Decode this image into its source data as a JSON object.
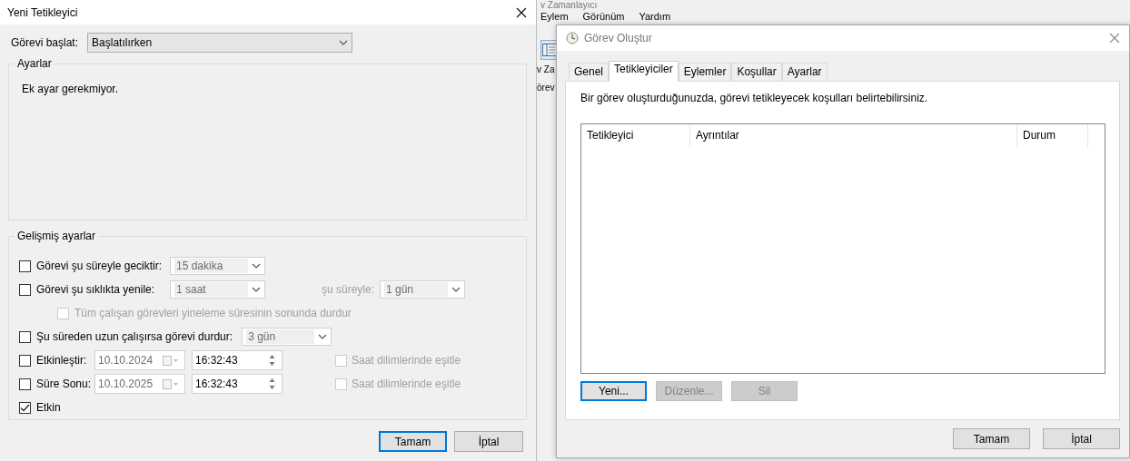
{
  "background_window": {
    "title": "v Zamanlayıcı",
    "menu": [
      "Eylem",
      "Görünüm",
      "Yardım"
    ],
    "side_labels": [
      "v Za",
      "örev"
    ]
  },
  "new_trigger_dialog": {
    "title": "Yeni Tetikleyici",
    "start_task": {
      "label": "Görevi başlat:",
      "value": "Başlatılırken"
    },
    "settings_group": {
      "title": "Ayarlar",
      "text": "Ek ayar gerekmiyor."
    },
    "advanced_group": {
      "title": "Gelişmiş ayarlar",
      "rows": [
        {
          "kind": "combo",
          "checked": false,
          "disabled": false,
          "label": "Görevi şu süreyle geciktir:",
          "value": "15 dakika"
        },
        {
          "kind": "repeat",
          "checked": false,
          "disabled": false,
          "label": "Görevi şu sıklıkta yenile:",
          "value": "1 saat",
          "duration_label": "şu süreyle:",
          "duration_value": "1 gün"
        },
        {
          "kind": "sub",
          "checked": false,
          "disabled": true,
          "label": "Tüm çalışan görevleri yineleme süresinin sonunda durdur"
        },
        {
          "kind": "stop",
          "checked": false,
          "disabled": false,
          "label": "Şu süreden uzun çalışırsa görevi durdur:",
          "value": "3 gün"
        },
        {
          "kind": "datetime",
          "checked": false,
          "disabled": false,
          "label": "Etkinleştir:",
          "date": "10.10.2024",
          "time": "16:32:43",
          "sync_label": "Saat dilimlerinde eşitle",
          "sync_checked": false
        },
        {
          "kind": "datetime",
          "checked": false,
          "disabled": false,
          "label": "Süre Sonu:",
          "date": "10.10.2025",
          "time": "16:32:43",
          "sync_label": "Saat dilimlerinde eşitle",
          "sync_checked": false
        },
        {
          "kind": "check",
          "checked": true,
          "disabled": false,
          "label": "Etkin"
        }
      ]
    },
    "buttons": [
      {
        "label": "Tamam",
        "focused": true
      },
      {
        "label": "İptal",
        "focused": false
      }
    ]
  },
  "create_task_dialog": {
    "title": "Görev Oluştur",
    "tabs": [
      {
        "label": "Genel",
        "selected": false
      },
      {
        "label": "Tetikleyiciler",
        "selected": true
      },
      {
        "label": "Eylemler",
        "selected": false
      },
      {
        "label": "Koşullar",
        "selected": false
      },
      {
        "label": "Ayarlar",
        "selected": false
      }
    ],
    "description": "Bir görev oluşturduğunuzda, görevi tetikleyecek koşulları belirtebilirsiniz.",
    "table": {
      "columns": [
        "Tetikleyici",
        "Ayrıntılar",
        "Durum"
      ]
    },
    "list_buttons": [
      {
        "label": "Yeni...",
        "focused": true,
        "disabled": false
      },
      {
        "label": "Düzenle...",
        "focused": false,
        "disabled": true
      },
      {
        "label": "Sil",
        "focused": false,
        "disabled": true
      }
    ],
    "buttons": [
      {
        "label": "Tamam",
        "focused": false
      },
      {
        "label": "İptal",
        "focused": false
      }
    ]
  }
}
